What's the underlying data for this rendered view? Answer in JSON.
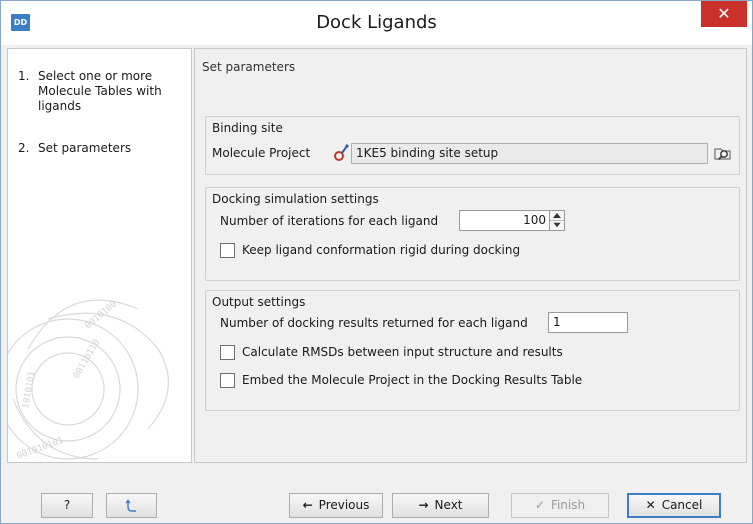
{
  "window": {
    "app_icon_text": "DD",
    "title": "Dock Ligands",
    "close_glyph": "✕"
  },
  "sidebar": {
    "steps": [
      {
        "number": "1.",
        "label": "Select one or more Molecule Tables with ligands"
      },
      {
        "number": "2.",
        "label": "Set parameters"
      }
    ]
  },
  "main": {
    "heading": "Set parameters",
    "binding_site": {
      "title": "Binding site",
      "project_label": "Molecule Project",
      "project_value": "1KE5 binding site setup",
      "browse_icon": "browse-folder-icon"
    },
    "docking": {
      "title": "Docking simulation settings",
      "iterations_label": "Number of iterations for each ligand",
      "iterations_value": "100",
      "rigid_label": "Keep ligand conformation rigid during docking",
      "rigid_checked": false
    },
    "output": {
      "title": "Output settings",
      "results_label": "Number of docking results returned for each ligand",
      "results_value": "1",
      "rmsd_label": "Calculate RMSDs between input structure and results",
      "rmsd_checked": false,
      "embed_label": "Embed the Molecule Project in the Docking Results Table",
      "embed_checked": false
    }
  },
  "footer": {
    "help_label": "?",
    "reset_icon": "reset-arrow-icon",
    "previous_label": "Previous",
    "previous_glyph": "←",
    "next_label": "Next",
    "next_glyph": "→",
    "finish_label": "Finish",
    "finish_glyph": "✓",
    "cancel_label": "Cancel",
    "cancel_glyph": "✕"
  },
  "colors": {
    "accent": "#3c7dc4",
    "close_red": "#c9312a",
    "panel_bg": "#f0f0f0",
    "art_stroke": "#d6d6d6"
  }
}
